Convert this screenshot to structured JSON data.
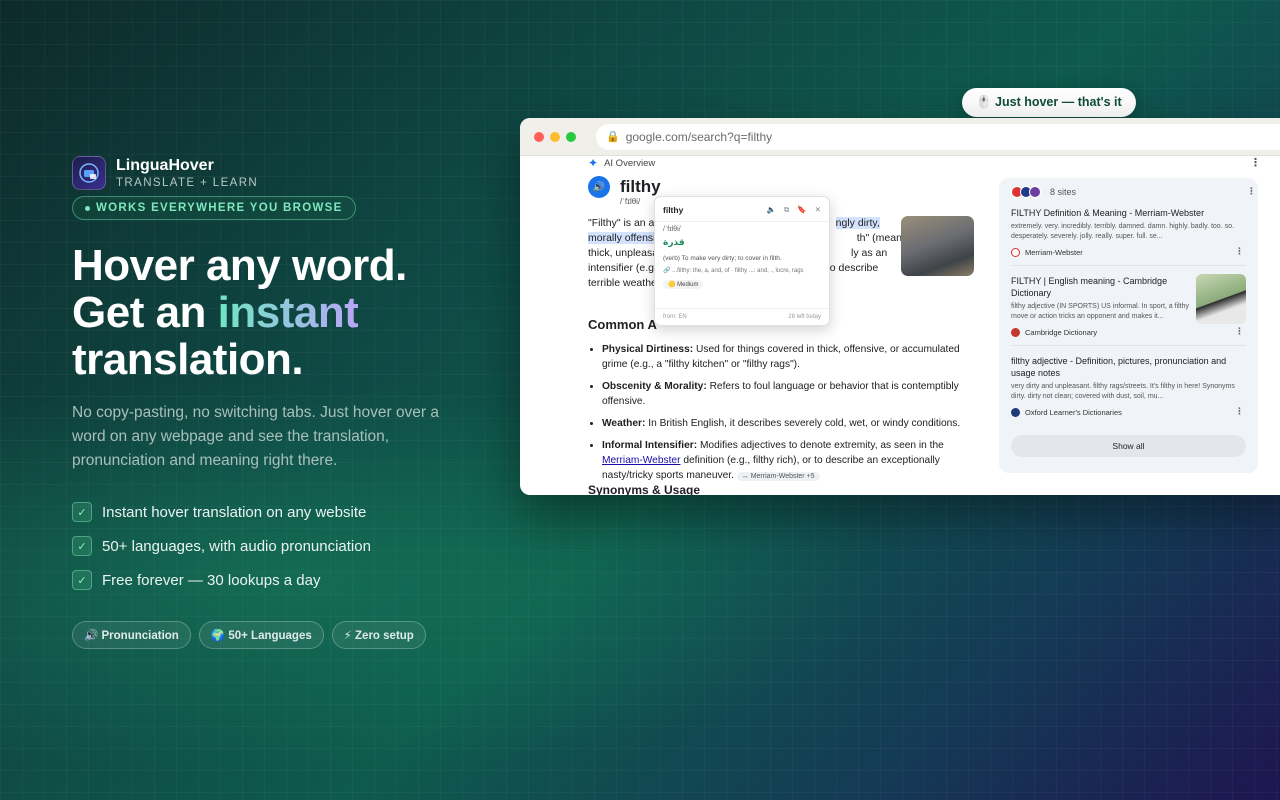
{
  "brand": {
    "name": "LinguaHover",
    "tagline": "TRANSLATE + LEARN",
    "works_pill": "WORKS EVERYWHERE YOU BROWSE"
  },
  "hero": {
    "line1": "Hover any word.",
    "line2_prefix": "Get an ",
    "line2_accent": "instant",
    "line3": "translation.",
    "subtext": "No copy-pasting, no switching tabs. Just hover over a word on any webpage and see the translation, pronunciation and meaning right there."
  },
  "features": [
    "Instant hover translation on any website",
    "50+ languages, with audio pronunciation",
    "Free forever — 30 lookups a day"
  ],
  "chips": [
    {
      "icon": "speaker-icon",
      "label": "🔊 Pronunciation"
    },
    {
      "icon": "globe-icon",
      "label": "🌍 50+ Languages"
    },
    {
      "icon": "bolt-icon",
      "label": "⚡ Zero setup"
    }
  ],
  "hover_bubble": "🖱️ Just hover — that's it",
  "browser": {
    "url": "google.com/search?q=filthy",
    "ai_overview_label": "AI Overview",
    "word": "filthy",
    "phonetic": "/ˈfɪlθi/",
    "para_a": "\"Filthy\" is an ac",
    "para_hl1": "ngly dirty,",
    "para_hl2": "morally offensiv",
    "para_b": "th\" (meaning",
    "para_c": "thick, unpleasa",
    "para_d": "ly as an",
    "para_e": "intensifier (e.g.",
    "para_f": "to describe",
    "para_g": "terrible weathe",
    "common_title": "Common A",
    "bullets": [
      {
        "term": "Physical Dirtiness:",
        "text": " Used for things covered in thick, offensive, or accumulated grime (e.g., a \"filthy kitchen\" or \"filthy rags\")."
      },
      {
        "term": "Obscenity & Morality:",
        "text": " Refers to foul language or behavior that is contemptibly offensive."
      },
      {
        "term": "Weather:",
        "text": " In British English, it describes severely cold, wet, or windy conditions."
      }
    ],
    "bullet4": {
      "term": "Informal Intensifier:",
      "text_a": " Modifies adjectives to denote extremity, as seen in the ",
      "link": "Merriam-Webster",
      "text_b": " definition (e.g., filthy rich), or to describe an exceptionally nasty/tricky sports maneuver.",
      "tag": "↔ Merriam-Webster +5"
    },
    "synonyms_title": "Synonyms & Usage"
  },
  "popup": {
    "word": "filthy",
    "phonetic": "/ˈfɪlθi/",
    "translation": "قذرة",
    "definition": "(verb) To make very dirty; to cover in filth.",
    "example": "🔗 ...filthy: the, a, and, of · filthy ...: and, ., lucre, rags",
    "level": "🟡 Medium",
    "from": "from: EN",
    "left": "28 left today"
  },
  "sidebar": {
    "sites_count": "8 sites",
    "items": [
      {
        "title": "FILTHY Definition & Meaning - Merriam-Webster",
        "desc": "extremely. very. incredibly. terribly. damned. damn. highly. badly. too. so. desperately. severely. jolly. really. super. full. se...",
        "source": "Merriam-Webster"
      },
      {
        "title": "FILTHY | English meaning - Cambridge Dictionary",
        "desc": "filthy adjective (IN SPORTS) US informal. In sport, a filthy move or action tricks an opponent and makes it...",
        "source": "Cambridge Dictionary"
      },
      {
        "title": "filthy adjective - Definition, pictures, pronunciation and usage notes",
        "desc": "very dirty and unpleasant. filthy rags/streets. It's filthy in here! Synonyms dirty. dirty not clean; covered with dust, soil, mu...",
        "source": "Oxford Learner's Dictionaries"
      }
    ],
    "show_all": "Show all"
  }
}
